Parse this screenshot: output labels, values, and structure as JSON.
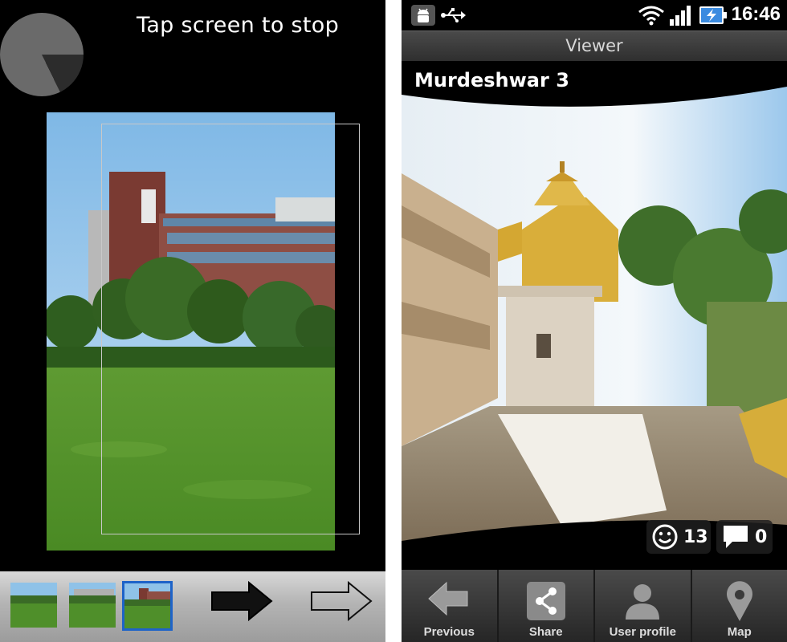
{
  "capture_screen": {
    "instruction": "Tap screen to stop",
    "thumbnails": [
      {
        "name": "frame-1"
      },
      {
        "name": "frame-2"
      },
      {
        "name": "frame-3",
        "selected": true
      }
    ],
    "accent_color": "#1e63c8"
  },
  "status_bar": {
    "time": "16:46",
    "icons": [
      "android-debug-icon",
      "usb-icon",
      "wifi-icon",
      "signal-icon",
      "battery-charging-icon"
    ]
  },
  "viewer": {
    "screen_title": "Viewer",
    "photo_title": "Murdeshwar 3",
    "likes_count": "13",
    "comments_count": "0",
    "nav": {
      "previous": "Previous",
      "share": "Share",
      "user_profile": "User profile",
      "map": "Map"
    }
  }
}
